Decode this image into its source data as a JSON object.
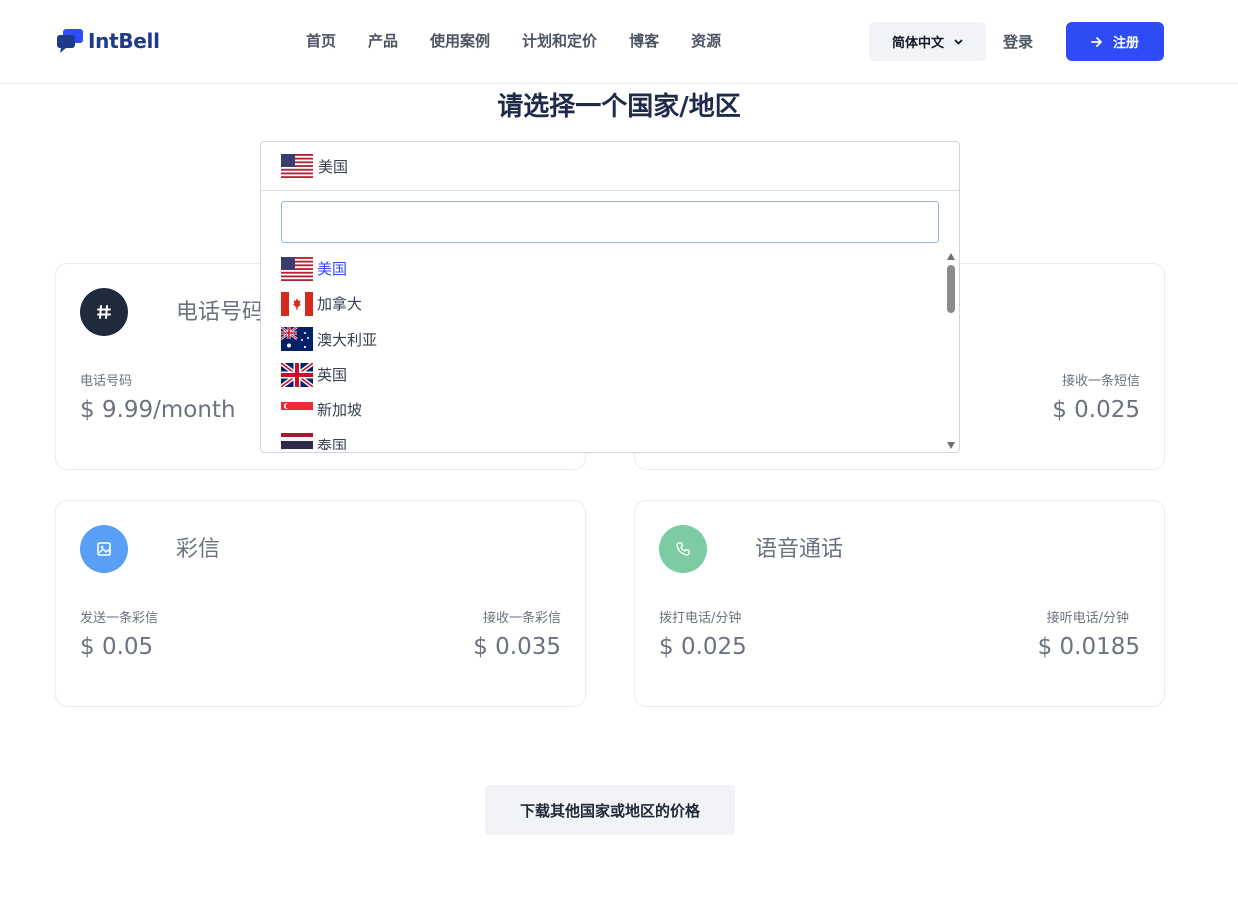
{
  "brand": {
    "name": "IntBell"
  },
  "nav": {
    "items": [
      "首页",
      "产品",
      "使用案例",
      "计划和定价",
      "博客",
      "资源"
    ]
  },
  "header": {
    "language": "简体中文",
    "login": "登录",
    "signup": "注册"
  },
  "page_title": "请选择一个国家/地区",
  "country_select": {
    "selected": "美国",
    "search_value": "",
    "options": [
      "美国",
      "加拿大",
      "澳大利亚",
      "英国",
      "新加坡",
      "泰国"
    ]
  },
  "cards": {
    "phone": {
      "title": "电话号码",
      "label_left": "电话号码",
      "price_left": "$ 9.99/month"
    },
    "sms": {
      "label_right": "接收一条短信",
      "price_right": "$ 0.025"
    },
    "mms": {
      "title": "彩信",
      "label_left": "发送一条彩信",
      "price_left": "$ 0.05",
      "label_right": "接收一条彩信",
      "price_right": "$ 0.035"
    },
    "voice": {
      "title": "语音通话",
      "label_left": "拨打电话/分钟",
      "price_left": "$ 0.025",
      "label_right": "接听电话/分钟",
      "price_right": "$ 0.0185"
    }
  },
  "download_button": "下载其他国家或地区的价格",
  "colors": {
    "accent": "#2f4bf5",
    "phone_icon_bg": "#1f2a3c",
    "mms_icon_bg": "#5a9ff7",
    "voice_icon_bg": "#7dcba2"
  },
  "icons": {
    "phone_card": "hash-icon",
    "mms_card": "image-icon",
    "voice_card": "phone-icon"
  }
}
